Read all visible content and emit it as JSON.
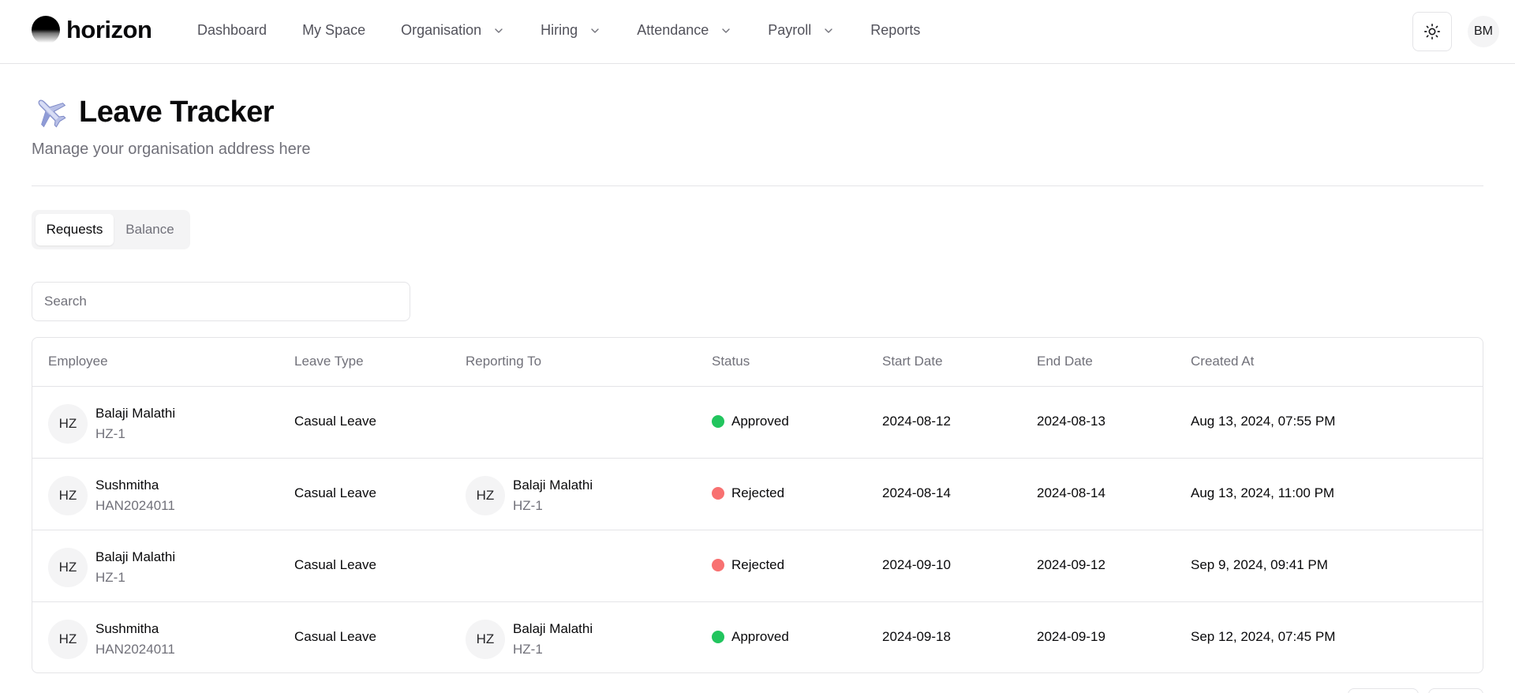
{
  "app": {
    "name": "horizon"
  },
  "nav": {
    "items": [
      {
        "label": "Dashboard",
        "dropdown": false
      },
      {
        "label": "My Space",
        "dropdown": false
      },
      {
        "label": "Organisation",
        "dropdown": true
      },
      {
        "label": "Hiring",
        "dropdown": true
      },
      {
        "label": "Attendance",
        "dropdown": true
      },
      {
        "label": "Payroll",
        "dropdown": true
      },
      {
        "label": "Reports",
        "dropdown": false
      }
    ],
    "user_initials": "BM"
  },
  "page": {
    "title": "Leave Tracker",
    "subtitle": "Manage your organisation address here",
    "icon": "airplane-icon"
  },
  "tabs": [
    {
      "label": "Requests",
      "active": true
    },
    {
      "label": "Balance",
      "active": false
    }
  ],
  "search": {
    "placeholder": "Search",
    "value": ""
  },
  "table": {
    "columns": [
      "Employee",
      "Leave Type",
      "Reporting To",
      "Status",
      "Start Date",
      "End Date",
      "Created At"
    ],
    "rows": [
      {
        "employee": {
          "initials": "HZ",
          "name": "Balaji Malathi",
          "code": "HZ-1"
        },
        "leave_type": "Casual Leave",
        "reporting_to": null,
        "status": {
          "label": "Approved",
          "color": "#22c55e"
        },
        "start_date": "2024-08-12",
        "end_date": "2024-08-13",
        "created_at": "Aug 13, 2024, 07:55 PM"
      },
      {
        "employee": {
          "initials": "HZ",
          "name": "Sushmitha",
          "code": "HAN2024011"
        },
        "leave_type": "Casual Leave",
        "reporting_to": {
          "initials": "HZ",
          "name": "Balaji Malathi",
          "code": "HZ-1"
        },
        "status": {
          "label": "Rejected",
          "color": "#f87171"
        },
        "start_date": "2024-08-14",
        "end_date": "2024-08-14",
        "created_at": "Aug 13, 2024, 11:00 PM"
      },
      {
        "employee": {
          "initials": "HZ",
          "name": "Balaji Malathi",
          "code": "HZ-1"
        },
        "leave_type": "Casual Leave",
        "reporting_to": null,
        "status": {
          "label": "Rejected",
          "color": "#f87171"
        },
        "start_date": "2024-09-10",
        "end_date": "2024-09-12",
        "created_at": "Sep 9, 2024, 09:41 PM"
      },
      {
        "employee": {
          "initials": "HZ",
          "name": "Sushmitha",
          "code": "HAN2024011"
        },
        "leave_type": "Casual Leave",
        "reporting_to": {
          "initials": "HZ",
          "name": "Balaji Malathi",
          "code": "HZ-1"
        },
        "status": {
          "label": "Approved",
          "color": "#22c55e"
        },
        "start_date": "2024-09-18",
        "end_date": "2024-09-19",
        "created_at": "Sep 12, 2024, 07:45 PM"
      }
    ]
  }
}
